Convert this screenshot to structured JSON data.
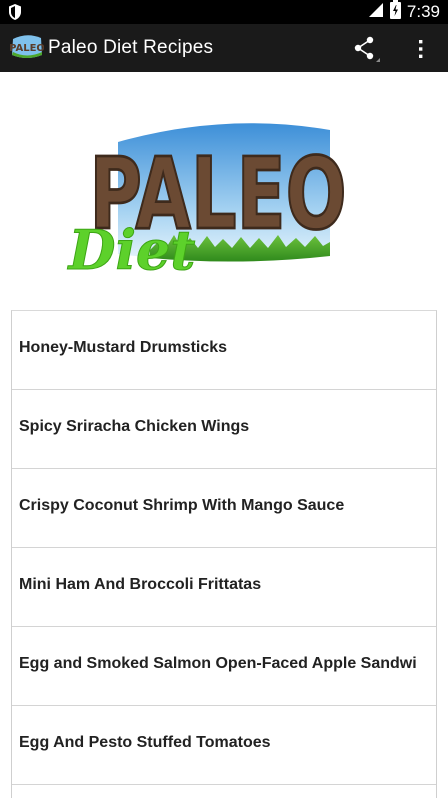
{
  "status_bar": {
    "time": "7:39",
    "icons": [
      "shield-icon",
      "signal-icon",
      "battery-icon"
    ]
  },
  "action_bar": {
    "title": "Paleo Diet Recipes",
    "icon_text": "PALEO",
    "actions": [
      "share-icon",
      "overflow-menu-icon"
    ]
  },
  "banner": {
    "logo_main": "PALEO",
    "logo_sub": "Diet"
  },
  "recipes": [
    {
      "title": "Honey-Mustard Drumsticks"
    },
    {
      "title": "Spicy Sriracha Chicken Wings"
    },
    {
      "title": "Crispy Coconut Shrimp With Mango Sauce"
    },
    {
      "title": "Mini Ham And Broccoli Frittatas"
    },
    {
      "title": "Egg and Smoked Salmon Open-Faced Apple Sandwi"
    },
    {
      "title": "Egg And Pesto Stuffed Tomatoes"
    }
  ],
  "colors": {
    "status_bar": "#000000",
    "action_bar": "#1a1a1a",
    "logo_brown": "#6b4a33",
    "logo_green": "#5dd12b",
    "sky_blue": "#5fa9e0"
  }
}
